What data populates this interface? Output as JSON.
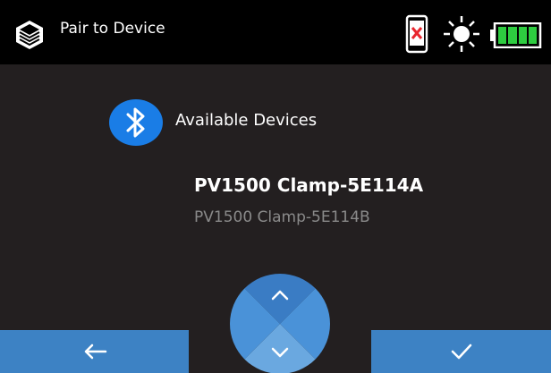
{
  "header": {
    "title": "Pair to Device",
    "icons": {
      "app": "app-logo-icon",
      "phone": "phone-disconnected-icon",
      "brightness": "sun-brightness-icon",
      "battery": "battery-full-icon"
    },
    "battery_level": 1.0
  },
  "main": {
    "section_icon": "bluetooth-icon",
    "section_title": "Available Devices",
    "devices": [
      {
        "name": "PV1500 Clamp-5E114A",
        "selected": true
      },
      {
        "name": "PV1500 Clamp-5E114B",
        "selected": false
      }
    ]
  },
  "footer": {
    "back_icon": "arrow-left-icon",
    "confirm_icon": "checkmark-icon",
    "dpad_icons": [
      "chevron-up-icon",
      "chevron-down-icon"
    ]
  },
  "colors": {
    "header_bg": "#000000",
    "body_bg": "#231f20",
    "accent_blue": "#3d82c4",
    "bluetooth_blue": "#1a7de6",
    "battery_green": "#2ecc40",
    "phone_x_red": "#e8262e",
    "secondary_text": "#8a8a8a"
  }
}
